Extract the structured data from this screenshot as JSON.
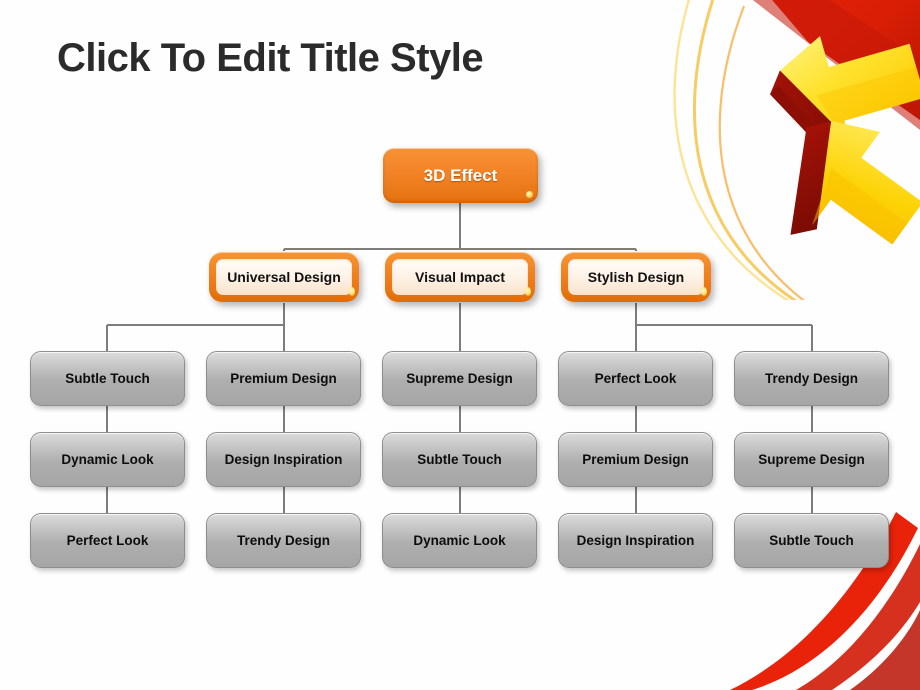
{
  "slide": {
    "title": "Click To Edit Title Style",
    "background_color": "#fefefe",
    "title_color": "#2b2b2b"
  },
  "theme": {
    "accent_orange": "#ef7c18",
    "accent_orange_light": "#f79435",
    "node_gray": "#b4b4b4",
    "connector_gray": "#7d7d7d",
    "deco_red": "#d81e05",
    "deco_dark_red": "#9e1007",
    "deco_yellow": "#fcd307",
    "deco_yellow_light": "#ffe766"
  },
  "chart_data": {
    "type": "diagram",
    "title": "Click To Edit Title Style",
    "orientation": "top-down",
    "levels": 4,
    "root": {
      "label": "3D Effect",
      "style": "orange-solid"
    },
    "branches": [
      {
        "label": "Universal Design",
        "style": "orange-outline"
      },
      {
        "label": "Visual Impact",
        "style": "orange-outline"
      },
      {
        "label": "Stylish Design",
        "style": "orange-outline"
      }
    ],
    "columns": [
      {
        "parent": "Universal Design",
        "nodes": [
          "Subtle Touch",
          "Dynamic Look",
          "Perfect Look"
        ]
      },
      {
        "parent": "Universal Design",
        "nodes": [
          "Premium Design",
          "Design Inspiration",
          "Trendy Design"
        ]
      },
      {
        "parent": "Visual Impact",
        "nodes": [
          "Supreme Design",
          "Subtle Touch",
          "Dynamic Look"
        ]
      },
      {
        "parent": "Stylish Design",
        "nodes": [
          "Perfect Look",
          "Premium Design",
          "Design Inspiration"
        ]
      },
      {
        "parent": "Stylish Design",
        "nodes": [
          "Trendy Design",
          "Supreme Design",
          "Subtle Touch"
        ]
      }
    ]
  },
  "nodes": {
    "root": "3D Effect",
    "b1": "Universal Design",
    "b2": "Visual Impact",
    "b3": "Stylish Design",
    "r1c1": "Subtle Touch",
    "r1c2": "Premium Design",
    "r1c3": "Supreme Design",
    "r1c4": "Perfect Look",
    "r1c5": "Trendy Design",
    "r2c1": "Dynamic Look",
    "r2c2": "Design Inspiration",
    "r2c3": "Subtle Touch",
    "r2c4": "Premium Design",
    "r2c5": "Supreme Design",
    "r3c1": "Perfect Look",
    "r3c2": "Trendy Design",
    "r3c3": "Dynamic Look",
    "r3c4": "Design Inspiration",
    "r3c5": "Subtle Touch"
  }
}
